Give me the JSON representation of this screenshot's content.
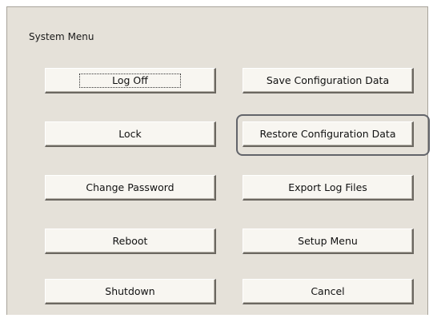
{
  "dialog": {
    "title": "System Menu"
  },
  "buttons": {
    "log_off": "Log Off",
    "lock": "Lock",
    "change_password": "Change Password",
    "reboot": "Reboot",
    "shutdown": "Shutdown",
    "save_configuration_data": "Save Configuration Data",
    "restore_configuration_data": "Restore Configuration Data",
    "export_log_files": "Export Log Files",
    "setup_menu": "Setup Menu",
    "cancel": "Cancel"
  },
  "state": {
    "keyboard_focus": "log_off",
    "highlighted": "restore_configuration_data"
  },
  "colors": {
    "background": "#e5e1d9",
    "button_face": "#f8f6f1",
    "highlight_ring": "#62646a"
  }
}
